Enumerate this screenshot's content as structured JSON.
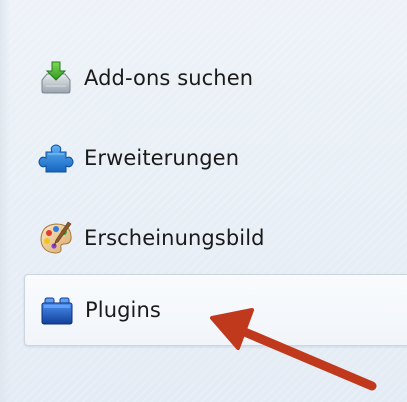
{
  "sidebar": {
    "items": [
      {
        "label": "Add-ons suchen",
        "icon": "get-addons-icon",
        "selected": false
      },
      {
        "label": "Erweiterungen",
        "icon": "puzzle-piece-icon",
        "selected": false
      },
      {
        "label": "Erscheinungsbild",
        "icon": "paint-palette-icon",
        "selected": false
      },
      {
        "label": "Plugins",
        "icon": "plugin-blocks-icon",
        "selected": true
      }
    ]
  },
  "colors": {
    "arrow": "#c0391d",
    "puzzle": "#1e7fd6",
    "plugin_block": "#1f5fc0",
    "download_arrow": "#3cae2a"
  }
}
